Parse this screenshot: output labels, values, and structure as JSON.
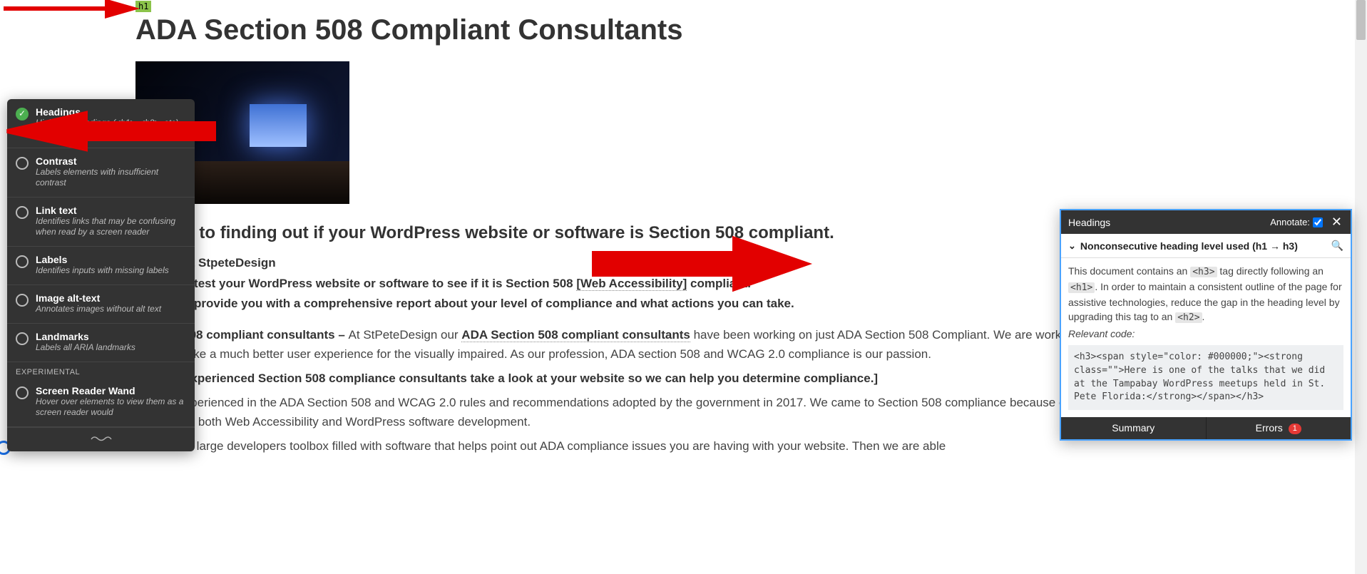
{
  "article": {
    "h1_badge": "h1",
    "title": "ADA Section 508 Compliant Consultants",
    "subheading": "3 steps to finding out if your WordPress website or software is Section 508 compliant.",
    "step1": "Contact StpeteDesign",
    "step2_pre": "We will test your WordPress website or software to see if it is Section 508 ",
    "step2_link": "[Web Accessibility]",
    "step2_post": " compliant.",
    "step3": "We will provide you with a comprehensive report about your level of compliance and what actions you can take.",
    "para1_strong": "Section 508 compliant consultants – ",
    "para1_rest": "At StPeteDesign our ",
    "para1_link": "ADA Section 508 compliant consultants",
    "para1_tail": " have been working on just ADA Section 508 Compliant. We are working hard to make a much better user experience for the visually impaired. As our profession, ADA section 508 and WCAG 2.0 compliance is our passion.",
    "callout": "[Let our experienced Section 508 compliance consultants take a look at your website so we can help you determine compliance.]",
    "para2": "We are experienced in the ADA Section 508 and WCAG 2.0 rules and recommendations adopted by the government in 2017. We came to Section 508 compliance because of our passion for both Web Accessibility and WordPress software development.",
    "para3": "We have a large developers toolbox filled with software that helps point out ADA compliance issues you are having with your website. Then we are able"
  },
  "a11y_menu": {
    "items": [
      {
        "title": "Headings",
        "desc": "Highlights headings (<h1>, <h2>, etc) and order violations",
        "checked": true
      },
      {
        "title": "Contrast",
        "desc": "Labels elements with insufficient contrast",
        "checked": false
      },
      {
        "title": "Link text",
        "desc": "Identifies links that may be confusing when read by a screen reader",
        "checked": false
      },
      {
        "title": "Labels",
        "desc": "Identifies inputs with missing labels",
        "checked": false
      },
      {
        "title": "Image alt-text",
        "desc": "Annotates images without alt text",
        "checked": false
      },
      {
        "title": "Landmarks",
        "desc": "Labels all ARIA landmarks",
        "checked": false
      }
    ],
    "experimental_label": "EXPERIMENTAL",
    "experimental_item": {
      "title": "Screen Reader Wand",
      "desc": "Hover over elements to view them as a screen reader would"
    }
  },
  "h_panel": {
    "header_title": "Headings",
    "annotate_label": "Annotate:",
    "annotate_checked": true,
    "issue_title": "Nonconsecutive heading level used (h1 → h3)",
    "body_pre": "This document contains an ",
    "body_chip1": "<h3>",
    "body_mid1": " tag directly following an ",
    "body_chip2": "<h1>",
    "body_mid2": ". In order to maintain a consistent outline of the page for assistive technologies, reduce the gap in the heading level by upgrading this tag to an ",
    "body_chip3": "<h2>",
    "body_end": ".",
    "relevant_label": "Relevant code:",
    "code": "<h3><span style=\"color: #000000;\"><strong class=\"\">Here is one of the talks that we did at the Tampabay WordPress meetups held in St. Pete Florida:</strong></span></h3>",
    "tab_summary": "Summary",
    "tab_errors": "Errors",
    "error_count": "1"
  }
}
